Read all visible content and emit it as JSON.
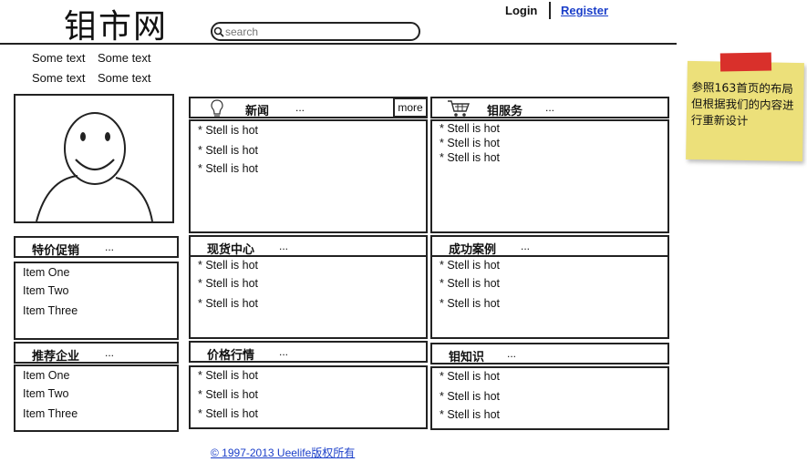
{
  "header": {
    "logo": "钼市网",
    "search_placeholder": "search",
    "login": "Login",
    "register": "Register"
  },
  "sub_links": [
    "Some text",
    "Some text",
    "Some text",
    "Some text"
  ],
  "left": {
    "promo": {
      "title": "特价促销",
      "dots": "...",
      "items": [
        "Item One",
        "Item Two",
        "Item Three"
      ]
    },
    "recommend": {
      "title": "推荐企业",
      "dots": "...",
      "items": [
        "Item One",
        "Item Two",
        "Item Three"
      ]
    }
  },
  "panels": {
    "news": {
      "title": "新闻",
      "dots": "...",
      "more": "more",
      "items": [
        "* Stell is hot",
        "* Stell is hot",
        "* Stell is hot"
      ]
    },
    "service": {
      "title": "钼服务",
      "dots": "...",
      "items": [
        "* Stell is hot",
        "* Stell is hot",
        "* Stell is hot"
      ]
    },
    "spot": {
      "title": "现货中心",
      "dots": "...",
      "items": [
        "* Stell is hot",
        "* Stell is hot",
        "* Stell is hot"
      ]
    },
    "cases": {
      "title": "成功案例",
      "dots": "...",
      "items": [
        "* Stell is hot",
        "* Stell is hot",
        "* Stell is hot"
      ]
    },
    "prices": {
      "title": "价格行情",
      "dots": "...",
      "items": [
        "* Stell is hot",
        "* Stell is hot",
        "* Stell is hot"
      ]
    },
    "knowledge": {
      "title": "钼知识",
      "dots": "...",
      "items": [
        "* Stell is hot",
        "* Stell is hot",
        "* Stell is hot"
      ]
    }
  },
  "sticky_note": "参照163首页的布局但根据我们的内容进行重新设计",
  "footer": "© 1997-2013 Ueelife版权所有"
}
